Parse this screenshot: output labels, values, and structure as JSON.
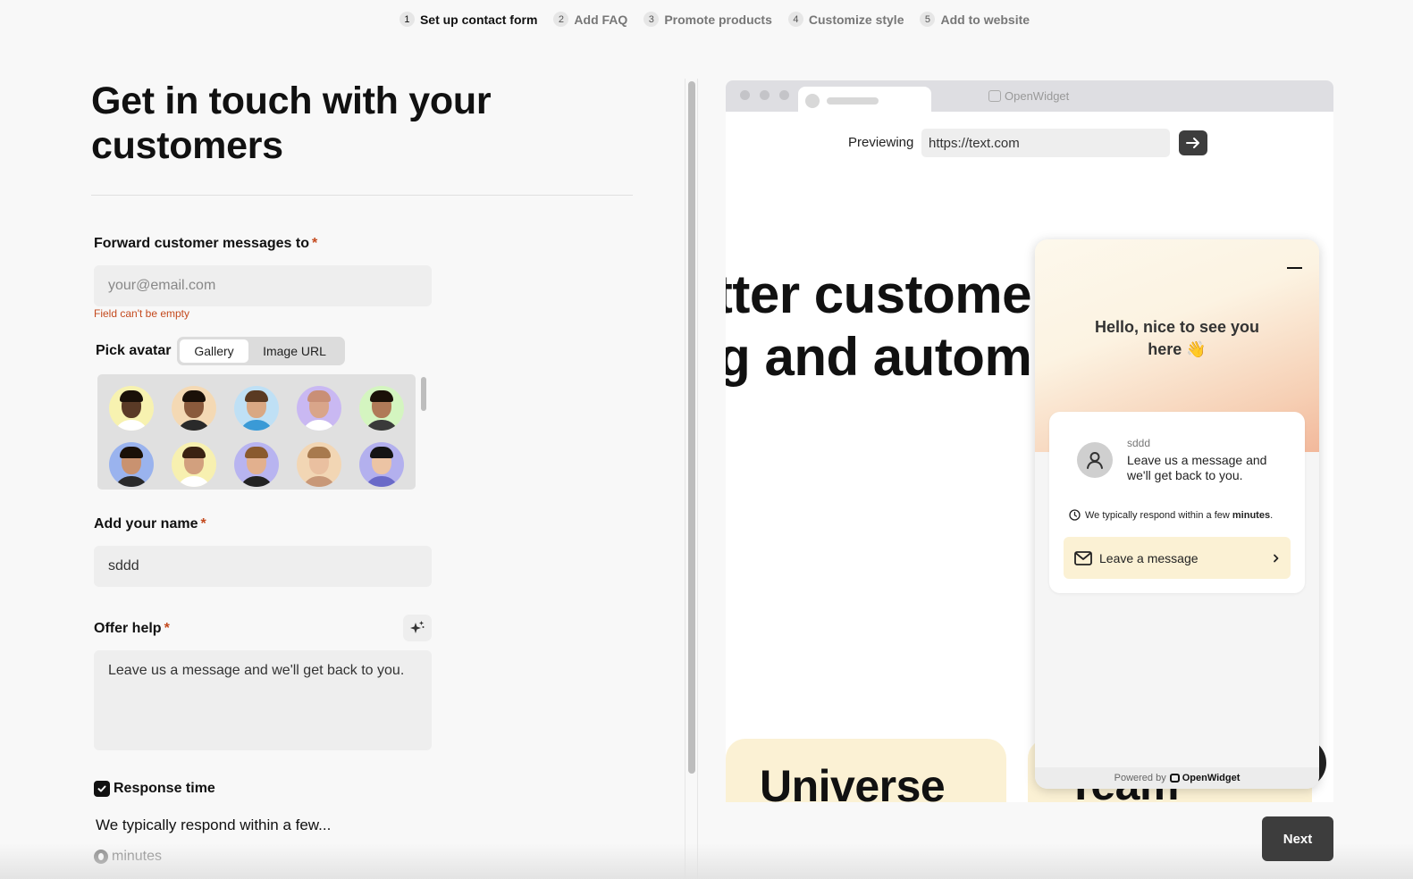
{
  "stepper": {
    "steps": [
      {
        "num": "1",
        "label": "Set up contact form",
        "active": true
      },
      {
        "num": "2",
        "label": "Add FAQ",
        "active": false
      },
      {
        "num": "3",
        "label": "Promote products",
        "active": false
      },
      {
        "num": "4",
        "label": "Customize style",
        "active": false
      },
      {
        "num": "5",
        "label": "Add to website",
        "active": false
      }
    ]
  },
  "form": {
    "title": "Get in touch with your customers",
    "required_mark": "*",
    "forward": {
      "label": "Forward customer messages to",
      "value": "",
      "placeholder": "your@email.com",
      "error": "Field can't be empty"
    },
    "avatar": {
      "label": "Pick avatar",
      "tabs": [
        "Gallery",
        "Image URL"
      ],
      "active_tab": "Gallery",
      "gallery": [
        {
          "bg": "#f7f2b0",
          "skin": "#5a3a26",
          "hair": "#1a1008",
          "shirt": "#ffffff"
        },
        {
          "bg": "#f4d9b4",
          "skin": "#8a5a3c",
          "hair": "#1a1008",
          "shirt": "#2a2a2a"
        },
        {
          "bg": "#bfe0f5",
          "skin": "#d9a884",
          "hair": "#5a3a22",
          "shirt": "#3a9ad6"
        },
        {
          "bg": "#c9b8f2",
          "skin": "#d9a58a",
          "hair": "#c98f76",
          "shirt": "#ffffff"
        },
        {
          "bg": "#d4f5c0",
          "skin": "#b07a58",
          "hair": "#1a1008",
          "shirt": "#3a3a3a"
        },
        {
          "bg": "#9ab3ee",
          "skin": "#c99270",
          "hair": "#1a1008",
          "shirt": "#2a2a2a"
        },
        {
          "bg": "#f7f0b0",
          "skin": "#d2a07e",
          "hair": "#3a2212",
          "shirt": "#ffffff"
        },
        {
          "bg": "#b8b4f0",
          "skin": "#e2b08e",
          "hair": "#8a5a2e",
          "shirt": "#222222"
        },
        {
          "bg": "#f2d6b4",
          "skin": "#eac0a0",
          "hair": "#a87a4e",
          "shirt": "#c89878"
        },
        {
          "bg": "#b3b0ee",
          "skin": "#ecc4a4",
          "hair": "#141414",
          "shirt": "#6a6ac8"
        }
      ]
    },
    "name": {
      "label": "Add your name",
      "value": "sddd"
    },
    "offer_help": {
      "label": "Offer help",
      "value": "Leave us a message and we'll get back to you.",
      "ai_icon": "sparkles-icon"
    },
    "response_time": {
      "label": "Response time",
      "checked": true,
      "text": "We typically respond within a few...",
      "option": "minutes"
    }
  },
  "preview": {
    "site_title": "OpenWidget",
    "previewing_label": "Previewing",
    "url": "https://text.com",
    "hero_line1": "etter custome",
    "hero_line2": "ng and autom",
    "card1": "Universe",
    "card2": "Team"
  },
  "widget": {
    "greeting": "Hello, nice to see you here 👋",
    "agent_name": "sddd",
    "message": "Leave us a message and we'll get back to you.",
    "response_prefix": "We typically respond within a few",
    "response_unit": "minutes",
    "response_suffix": ".",
    "button_label": "Leave a message",
    "powered_by": "Powered by",
    "brand": "OpenWidget"
  },
  "actions": {
    "next": "Next"
  },
  "colors": {
    "accent": "#3d3d3d",
    "error": "#c44a1e",
    "widget_button": "#fbf1d4"
  }
}
